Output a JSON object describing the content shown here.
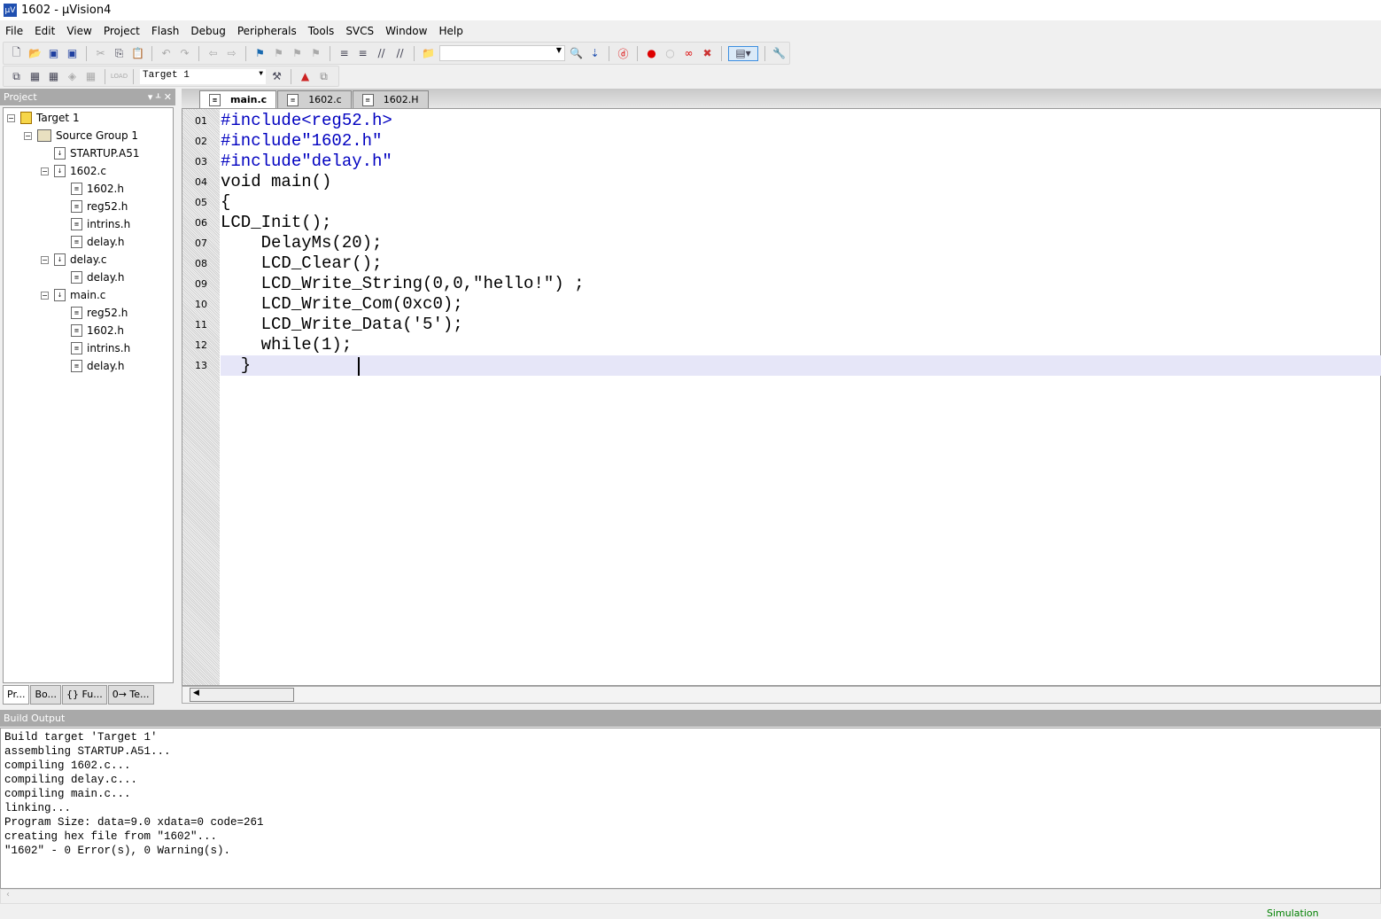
{
  "window": {
    "title": "1602  - µVision4",
    "icon": "uvision-icon"
  },
  "menu": [
    "File",
    "Edit",
    "View",
    "Project",
    "Flash",
    "Debug",
    "Peripherals",
    "Tools",
    "SVCS",
    "Window",
    "Help"
  ],
  "toolbar2": {
    "target": "Target 1"
  },
  "project": {
    "title": "Project",
    "tabs": [
      "Pr...",
      "Bo...",
      "{} Fu...",
      "0→ Te..."
    ],
    "tree": [
      {
        "label": "Target 1",
        "level": 0,
        "type": "target",
        "toggle": "-"
      },
      {
        "label": "Source Group 1",
        "level": 1,
        "type": "folder",
        "toggle": "-"
      },
      {
        "label": "STARTUP.A51",
        "level": 2,
        "type": "file"
      },
      {
        "label": "1602.c",
        "level": 2,
        "type": "file",
        "toggle": "-"
      },
      {
        "label": "1602.h",
        "level": 3,
        "type": "header"
      },
      {
        "label": "reg52.h",
        "level": 3,
        "type": "header"
      },
      {
        "label": "intrins.h",
        "level": 3,
        "type": "header"
      },
      {
        "label": "delay.h",
        "level": 3,
        "type": "header"
      },
      {
        "label": "delay.c",
        "level": 2,
        "type": "file",
        "toggle": "-"
      },
      {
        "label": "delay.h",
        "level": 3,
        "type": "header"
      },
      {
        "label": "main.c",
        "level": 2,
        "type": "file",
        "toggle": "-"
      },
      {
        "label": "reg52.h",
        "level": 3,
        "type": "header"
      },
      {
        "label": "1602.h",
        "level": 3,
        "type": "header"
      },
      {
        "label": "intrins.h",
        "level": 3,
        "type": "header"
      },
      {
        "label": "delay.h",
        "level": 3,
        "type": "header"
      }
    ]
  },
  "editor": {
    "tabs": [
      {
        "label": "main.c",
        "active": true
      },
      {
        "label": "1602.c"
      },
      {
        "label": "1602.H"
      }
    ],
    "lines": [
      {
        "n": "01",
        "code": "#include<reg52.h>"
      },
      {
        "n": "02",
        "code": "#include\"1602.h\""
      },
      {
        "n": "03",
        "code": "#include\"delay.h\""
      },
      {
        "n": "04",
        "code": "void main()"
      },
      {
        "n": "05",
        "code": "{"
      },
      {
        "n": "06",
        "code": "LCD_Init();"
      },
      {
        "n": "07",
        "code": "    DelayMs(20);"
      },
      {
        "n": "08",
        "code": "    LCD_Clear();"
      },
      {
        "n": "09",
        "code": "    LCD_Write_String(0,0,\"hello!\") ;"
      },
      {
        "n": "10",
        "code": "    LCD_Write_Com(0xc0);"
      },
      {
        "n": "11",
        "code": "    LCD_Write_Data('5');"
      },
      {
        "n": "12",
        "code": "    while(1);"
      },
      {
        "n": "13",
        "code": "  }"
      }
    ],
    "current_line": "13",
    "highlight_color": "#e6e6f8"
  },
  "build_output": {
    "title": "Build Output",
    "lines": [
      "Build target 'Target 1'",
      "assembling STARTUP.A51...",
      "compiling 1602.c...",
      "compiling delay.c...",
      "compiling main.c...",
      "linking...",
      "Program Size: data=9.0 xdata=0 code=261",
      "creating hex file from \"1602\"...",
      "\"1602\" - 0 Error(s), 0 Warning(s)."
    ]
  },
  "status": {
    "mode": "Simulation"
  }
}
